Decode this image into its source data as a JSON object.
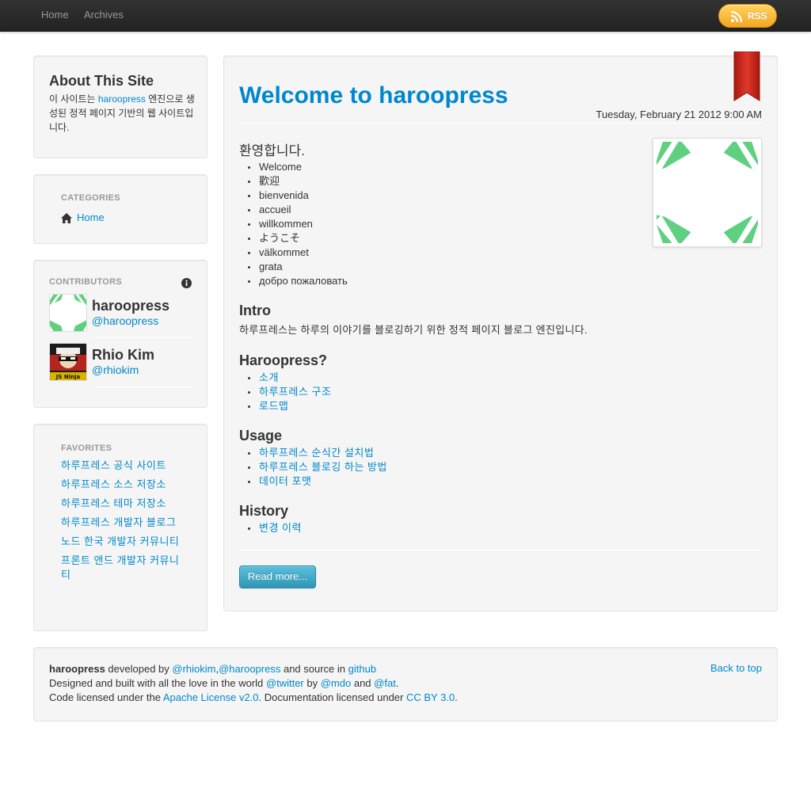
{
  "navbar": {
    "links": [
      "Home",
      "Archives"
    ],
    "rss_label": "RSS"
  },
  "sidebar": {
    "about": {
      "title": "About This Site",
      "text_before": "이 사이트는 ",
      "link": "haroopress",
      "text_after": " 엔진으로 생성된 정적 페이지 기반의 웹 사이트입니다."
    },
    "categories": {
      "header": "Categories",
      "items": [
        "Home"
      ]
    },
    "contributors": {
      "header": "Contributors",
      "people": [
        {
          "name": "haroopress",
          "handle": "@haroopress"
        },
        {
          "name": "Rhio Kim",
          "handle": "@rhiokim"
        }
      ],
      "ninja_badge": "JS Ninja"
    },
    "favorites": {
      "header": "Favorites",
      "items": [
        "하루프레스 공식 사이트",
        "하루프레스 소스 저장소",
        "하루프레스 테마 저장소",
        "하루프레스 개발자 블로그",
        "노드 한국 개발자 커뮤니티",
        "프론트 앤드 개발자 커뮤니티"
      ]
    }
  },
  "article": {
    "title": "Welcome to haroopress",
    "date": "Tuesday, February 21 2012 9:00 AM",
    "welcome_heading": "환영합니다.",
    "greetings": [
      "Welcome",
      "歡迎",
      "bienvenida",
      "accueil",
      "willkommen",
      "ようこそ",
      "välkommet",
      "grata",
      "добро пожаловать"
    ],
    "intro": {
      "heading": "Intro",
      "text": "하루프레스는 하루의 이야기를 블로깅하기 위한 정적 페이지 블로그 엔진입니다."
    },
    "haroopress": {
      "heading": "Haroopress?",
      "links": [
        "소개",
        "하루프레스 구조",
        "로드맵"
      ]
    },
    "usage": {
      "heading": "Usage",
      "links": [
        "하루프레스 순식간 설치법",
        "하루프레스 블로깅 하는 방법",
        "데이터 포맷"
      ]
    },
    "history": {
      "heading": "History",
      "links": [
        "변경 이력"
      ]
    },
    "read_more": "Read more..."
  },
  "footer": {
    "brand": "haroopress",
    "developed_by": " developed by ",
    "dev1": "@rhiokim",
    "comma": ",",
    "dev2": "@haroopress",
    "source_in": " and source in ",
    "github": "github",
    "line2_a": "Designed and built with all the love in the world ",
    "twitter": "@twitter",
    "by": " by ",
    "mdo": "@mdo",
    "and": " and ",
    "fat": "@fat",
    "period": ".",
    "line3_a": "Code licensed under the ",
    "apache": "Apache License v2.0",
    "line3_b": ". Documentation licensed under ",
    "ccby": "CC BY 3.0",
    "back_to_top": "Back to top"
  },
  "colors": {
    "link": "#0088cc",
    "navbar": "#222222",
    "rss": "#f5a623",
    "ribbon": "#cc2a1f",
    "read_more": "#2f96b4",
    "logo_green": "#5fcf80"
  }
}
